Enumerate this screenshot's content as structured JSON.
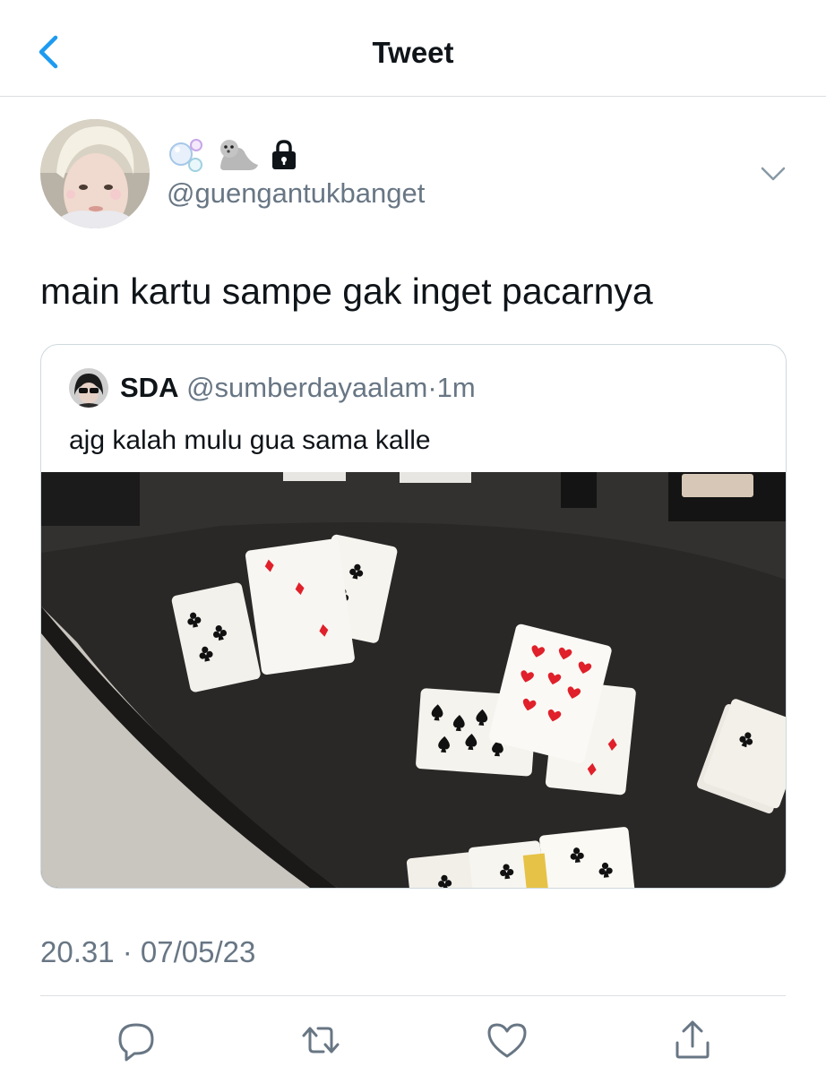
{
  "header": {
    "title": "Tweet",
    "back_icon": "chevron-left-icon",
    "accent": "#1d9bf0"
  },
  "tweet": {
    "display_name_icons": [
      "bubbles-emoji",
      "seal-emoji",
      "lock-icon"
    ],
    "handle": "@guengantukbanget",
    "text": "main kartu sampe gak inget pacarnya",
    "timestamp": "20.31 · 07/05/23",
    "menu_icon": "chevron-down-icon"
  },
  "quote": {
    "name": "SDA",
    "handle": "@sumberdayaalam",
    "separator": "·",
    "time": "1m",
    "text": "ajg kalah mulu gua sama kalle",
    "media": "photo of playing cards on a black table"
  },
  "actions": [
    "reply-icon",
    "retweet-icon",
    "like-icon",
    "share-icon"
  ],
  "colors": {
    "text": "#0f1419",
    "secondary": "#687684",
    "divider": "#dcdfe3"
  }
}
